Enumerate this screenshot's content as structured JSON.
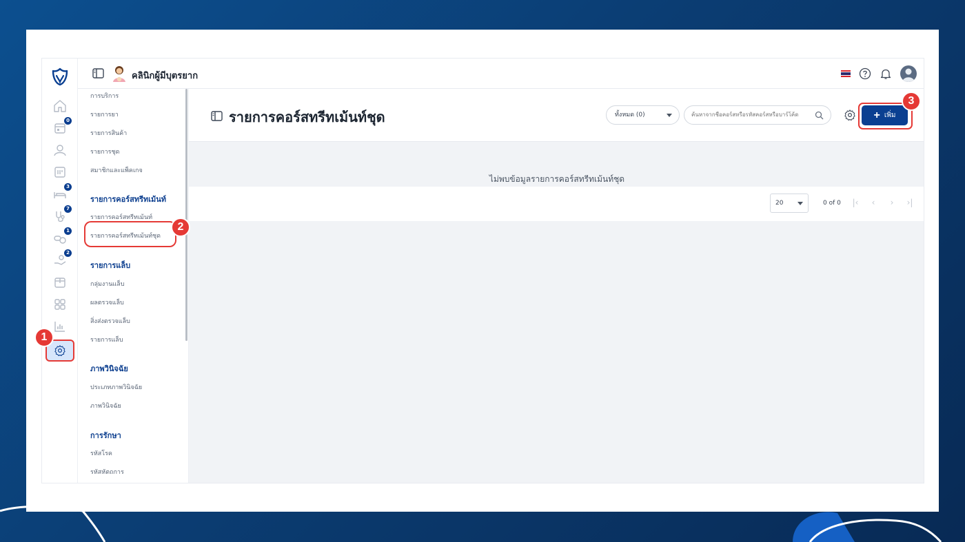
{
  "header": {
    "clinic_name": "คลินิกผู้มีบุตรยาก"
  },
  "rail": {
    "badges": {
      "calendar": "0",
      "bed": "3",
      "stethoscope": "7",
      "pills": "1",
      "hand": "2"
    }
  },
  "submenu": {
    "items_top": [
      "การบริการ",
      "รายการยา",
      "รายการสินค้า",
      "รายการชุด",
      "สมาชิกและแพ็คเกจ"
    ],
    "section_course": {
      "title": "รายการคอร์สทรีทเม้นท์",
      "items": [
        "รายการคอร์สทรีทเม้นท์",
        "รายการคอร์สทรีทเม้นท์ชุด"
      ]
    },
    "section_lab": {
      "title": "รายการแล็บ",
      "items": [
        "กลุ่มงานแล็บ",
        "ผลตรวจแล็บ",
        "สิ่งส่งตรวจแล็บ",
        "รายการแล็บ"
      ]
    },
    "section_imaging": {
      "title": "ภาพวินิจฉัย",
      "items": [
        "ประเภทภาพวินิจฉัย",
        "ภาพวินิจฉัย"
      ]
    },
    "section_treat": {
      "title": "การรักษา",
      "items": [
        "รหัสโรค",
        "รหัสหัตถการ"
      ]
    }
  },
  "main": {
    "title": "รายการคอร์สทรีทเม้นท์ชุด",
    "filter": {
      "selected": "ทั้งหมด (0)"
    },
    "search": {
      "placeholder": "ค้นหาจากชื่อคอร์สหรือรหัสคอร์สหรือบาร์โค้ด"
    },
    "add_label": "เพิ่ม",
    "empty_message": "ไม่พบข้อมูลรายการคอร์สทรีทเม้นท์ชุด",
    "pagination": {
      "page_size": "20",
      "range": "0 of 0"
    }
  },
  "steps": [
    "1",
    "2",
    "3"
  ],
  "colors": {
    "primary": "#0a3f91",
    "highlight": "#e53935",
    "accent_blue": "#0d3f8f"
  }
}
